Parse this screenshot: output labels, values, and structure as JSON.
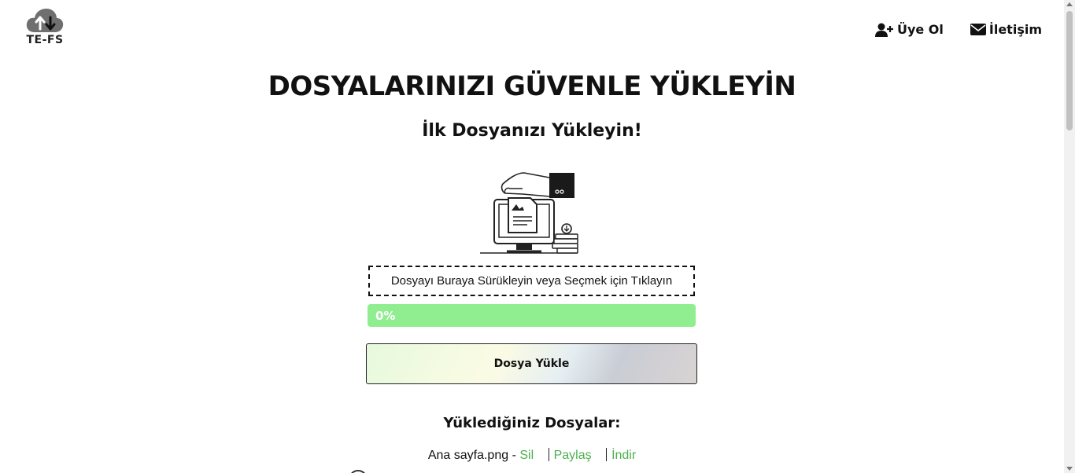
{
  "header": {
    "logo_text": "TE-FS",
    "logo_icon": "cloud-upload-download-icon",
    "nav": [
      {
        "label": "Üye Ol",
        "icon": "user-plus-icon"
      },
      {
        "label": "İletişim",
        "icon": "envelope-icon"
      }
    ]
  },
  "main": {
    "title": "DOSYALARINIZI GÜVENLE YÜKLEYİN",
    "subtitle": "İlk Dosyanızı Yükleyin!",
    "dropzone_label": "Dosyayı Buraya Sürükleyin veya Seçmek için Tıklayın",
    "progress": {
      "value": 0,
      "text": "0%"
    },
    "upload_button": "Dosya Yükle",
    "files_title": "Yüklediğiniz Dosyalar:",
    "files": [
      {
        "name": "Ana sayfa.png",
        "dash": "-",
        "delete": "Sil",
        "share": "Paylaş",
        "download": "İndir"
      }
    ]
  },
  "colors": {
    "progress_fill": "#90ee90",
    "link_green": "#4caf50",
    "text": "#111111"
  }
}
